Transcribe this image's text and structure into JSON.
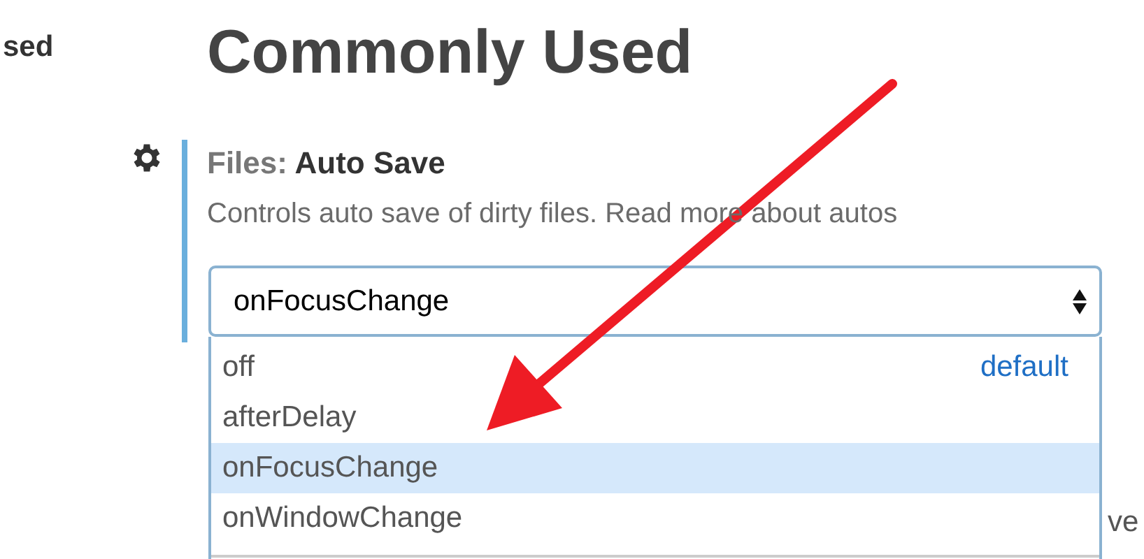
{
  "sidebar": {
    "item": "sed"
  },
  "section": {
    "title": "Commonly Used"
  },
  "setting": {
    "category": "Files:",
    "name": "Auto Save",
    "description": "Controls auto save of dirty files. Read more about autos",
    "modified": true,
    "select": {
      "value": "onFocusChange",
      "options": [
        {
          "label": "off",
          "selected": false,
          "note": "default"
        },
        {
          "label": "afterDelay",
          "selected": false
        },
        {
          "label": "onFocusChange",
          "selected": true
        },
        {
          "label": "onWindowChange",
          "selected": false
        }
      ]
    }
  },
  "behind_text": "ve"
}
